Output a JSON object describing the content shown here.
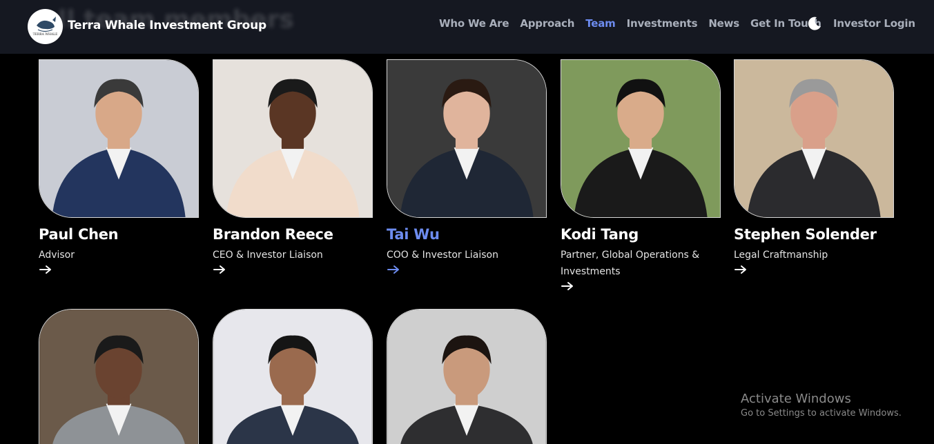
{
  "header": {
    "brand": "Terra Whale Investment Group",
    "logo_text": "TERRA WHALE",
    "ghost_heading": "ll team members",
    "nav": [
      {
        "label": "Who We Are"
      },
      {
        "label": "Approach"
      },
      {
        "label": "Team",
        "active": true
      },
      {
        "label": "Investments"
      },
      {
        "label": "News"
      },
      {
        "label": "Get In Touch"
      }
    ],
    "theme_icon": "moon-icon",
    "investor_login": "Investor Login"
  },
  "team": [
    {
      "name": "Paul Chen",
      "role": "Advisor",
      "bg": "#c9ccd4",
      "suit": "#23355e",
      "skin": "#d8a888",
      "hair": "#3a3a3a"
    },
    {
      "name": "Brandon Reece",
      "role": "CEO & Investor Liaison",
      "bg": "#e6e1dc",
      "suit": "#f1dccb",
      "skin": "#5a3624",
      "hair": "#1a1a1a"
    },
    {
      "name": "Tai Wu",
      "role": "COO & Investor Liaison",
      "bg": "#3a3a3a",
      "suit": "#1f2735",
      "skin": "#e0b49c",
      "hair": "#2a1a12",
      "highlight": true
    },
    {
      "name": "Kodi Tang",
      "role": "Partner, Global Operations & Investments",
      "bg": "#7f9a5c",
      "suit": "#1a1a1a",
      "skin": "#d9ab8a",
      "hair": "#111"
    },
    {
      "name": "Stephen Solender",
      "role": "Legal Craftmanship",
      "bg": "#cbb89c",
      "suit": "#2b2b2e",
      "skin": "#d9a08a",
      "hair": "#9a9a9a"
    },
    {
      "bg": "#6b5a4a",
      "suit": "#8e9296",
      "skin": "#6a4330",
      "hair": "#1a1a1a"
    },
    {
      "bg": "#e7e7ec",
      "suit": "#2b3548",
      "skin": "#9a6a4e",
      "hair": "#151515"
    },
    {
      "bg": "#cfcfcf",
      "suit": "#2e2e30",
      "skin": "#c99a7c",
      "hair": "#1c1410"
    }
  ],
  "watermark": {
    "title": "Activate Windows",
    "subtitle": "Go to Settings to activate Windows."
  }
}
